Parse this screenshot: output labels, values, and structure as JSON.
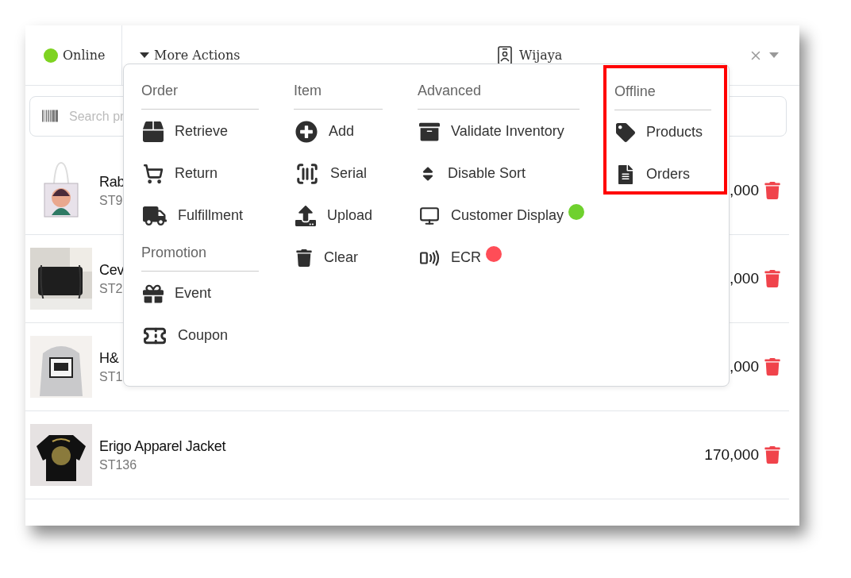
{
  "header": {
    "status": {
      "label": "Online",
      "color": "#7ed321"
    },
    "more_actions": {
      "label": "More Actions",
      "expanded": true
    },
    "customer": {
      "name": "Wijaya"
    }
  },
  "search": {
    "placeholder": "Search pr"
  },
  "items": [
    {
      "name": "Rab",
      "code": "ST9",
      "price": ",000",
      "kind": "picture"
    },
    {
      "name": "Cev",
      "code": "ST2",
      "price": ",000",
      "kind": "picture"
    },
    {
      "name": "H&",
      "code": "ST1",
      "price": ",000",
      "kind": "picture"
    },
    {
      "name": "Erigo Apparel Jacket",
      "code": "ST136",
      "price": "170,000",
      "kind": "picture"
    }
  ],
  "menu": {
    "columns": [
      {
        "highlighted": false,
        "sections": [
          {
            "heading": "Order",
            "items": [
              {
                "label": "Retrieve"
              },
              {
                "label": "Return"
              },
              {
                "label": "Fulfillment"
              }
            ]
          },
          {
            "heading": "Promotion",
            "items": [
              {
                "label": "Event"
              },
              {
                "label": "Coupon"
              }
            ]
          }
        ]
      },
      {
        "highlighted": false,
        "sections": [
          {
            "heading": "Item",
            "items": [
              {
                "label": "Add"
              },
              {
                "label": "Serial"
              },
              {
                "label": "Upload"
              },
              {
                "label": "Clear"
              }
            ]
          }
        ]
      },
      {
        "highlighted": false,
        "sections": [
          {
            "heading": "Advanced",
            "items": [
              {
                "label": "Validate Inventory"
              },
              {
                "label": "Disable Sort"
              },
              {
                "label": "Customer Display",
                "color": "#6fd12e"
              },
              {
                "label": "ECR",
                "color": "#ff4d57"
              }
            ]
          }
        ]
      },
      {
        "highlighted": true,
        "sections": [
          {
            "heading": "Offline",
            "items": [
              {
                "label": "Products"
              },
              {
                "label": "Orders"
              }
            ]
          }
        ]
      }
    ]
  }
}
